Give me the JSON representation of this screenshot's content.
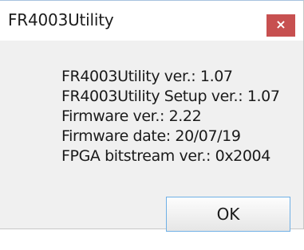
{
  "window": {
    "title": "FR4003Utility",
    "close_label": "×"
  },
  "info": {
    "lines": [
      "FR4003Utility ver.: 1.07",
      "FR4003Utility Setup ver.: 1.07",
      "Firmware ver.: 2.22",
      "Firmware date: 20/07/19",
      "FPGA bitstream ver.: 0x2004"
    ]
  },
  "buttons": {
    "ok_label": "OK"
  },
  "colors": {
    "close_button_bg": "#c75050",
    "dialog_bg": "#f0f0f0",
    "ok_border": "#6fb0e6"
  }
}
